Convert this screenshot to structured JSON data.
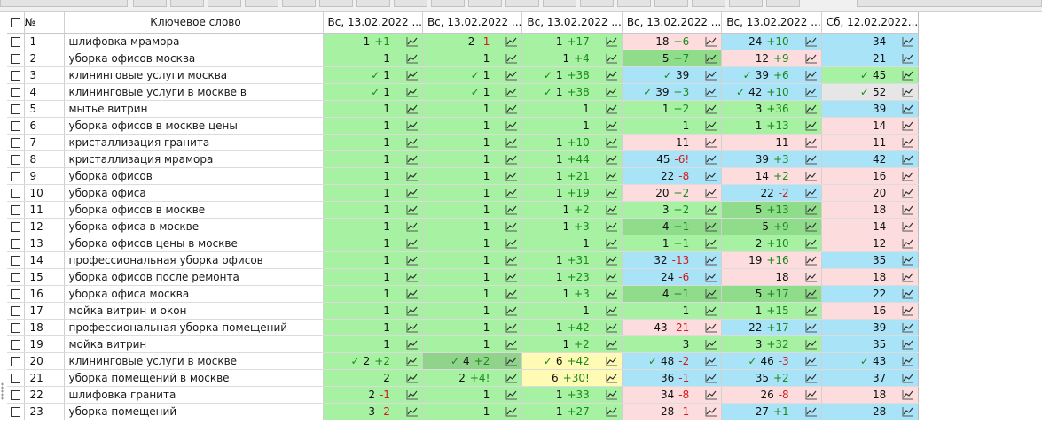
{
  "header": {
    "num": "№",
    "keyword": "Ключевое слово",
    "days": [
      "Вс, 13.02.2022 ...",
      "Вс, 13.02.2022 ...",
      "Вс, 13.02.2022 ...",
      "Вс, 13.02.2022 ...",
      "Вс, 13.02.2022 ...",
      "Сб, 12.02.2022..."
    ]
  },
  "colors": {
    "green": "#a6f2a2",
    "dgreen": "#8fdc8a",
    "pink": "#fcdcdc",
    "blue": "#a9e3f7",
    "yellow": "#fffbb5",
    "gray": "#e6e6e6",
    "up": "#1a8a1a",
    "down": "#d41a1a"
  },
  "icons": {
    "trend": "trend-chart-icon",
    "check": "checkmark"
  },
  "rows": [
    {
      "n": "1",
      "kw": "шлифовка мрамора",
      "c": [
        [
          "green",
          false,
          "1",
          "+1"
        ],
        [
          "green",
          false,
          "2",
          "-1"
        ],
        [
          "green",
          false,
          "1",
          "+17"
        ],
        [
          "pink",
          false,
          "18",
          "+6"
        ],
        [
          "blue",
          false,
          "24",
          "+10"
        ],
        [
          "blue",
          false,
          "34",
          ""
        ]
      ]
    },
    {
      "n": "2",
      "kw": "уборка офисов москва",
      "c": [
        [
          "green",
          false,
          "1",
          ""
        ],
        [
          "green",
          false,
          "1",
          ""
        ],
        [
          "green",
          false,
          "1",
          "+4"
        ],
        [
          "dgreen",
          false,
          "5",
          "+7"
        ],
        [
          "pink",
          false,
          "12",
          "+9"
        ],
        [
          "blue",
          false,
          "21",
          ""
        ]
      ]
    },
    {
      "n": "3",
      "kw": "клининговые услуги москва",
      "c": [
        [
          "green",
          true,
          "1",
          ""
        ],
        [
          "green",
          true,
          "1",
          ""
        ],
        [
          "green",
          true,
          "1",
          "+38"
        ],
        [
          "blue",
          true,
          "39",
          ""
        ],
        [
          "blue",
          true,
          "39",
          "+6"
        ],
        [
          "green",
          true,
          "45",
          ""
        ]
      ]
    },
    {
      "n": "4",
      "kw": "клининговые услуги в москве в",
      "c": [
        [
          "green",
          true,
          "1",
          ""
        ],
        [
          "green",
          true,
          "1",
          ""
        ],
        [
          "green",
          true,
          "1",
          "+38"
        ],
        [
          "blue",
          true,
          "39",
          "+3"
        ],
        [
          "blue",
          true,
          "42",
          "+10"
        ],
        [
          "gray",
          true,
          "52",
          ""
        ]
      ]
    },
    {
      "n": "5",
      "kw": "мытье витрин",
      "c": [
        [
          "green",
          false,
          "1",
          ""
        ],
        [
          "green",
          false,
          "1",
          ""
        ],
        [
          "green",
          false,
          "1",
          ""
        ],
        [
          "green",
          false,
          "1",
          "+2"
        ],
        [
          "green",
          false,
          "3",
          "+36"
        ],
        [
          "blue",
          false,
          "39",
          ""
        ]
      ]
    },
    {
      "n": "6",
      "kw": "уборка офисов в москве цены",
      "c": [
        [
          "green",
          false,
          "1",
          ""
        ],
        [
          "green",
          false,
          "1",
          ""
        ],
        [
          "green",
          false,
          "1",
          ""
        ],
        [
          "green",
          false,
          "1",
          ""
        ],
        [
          "green",
          false,
          "1",
          "+13"
        ],
        [
          "pink",
          false,
          "14",
          ""
        ]
      ]
    },
    {
      "n": "7",
      "kw": "кристаллизация гранита",
      "c": [
        [
          "green",
          false,
          "1",
          ""
        ],
        [
          "green",
          false,
          "1",
          ""
        ],
        [
          "green",
          false,
          "1",
          "+10"
        ],
        [
          "pink",
          false,
          "11",
          ""
        ],
        [
          "pink",
          false,
          "11",
          ""
        ],
        [
          "pink",
          false,
          "11",
          ""
        ]
      ]
    },
    {
      "n": "8",
      "kw": "кристаллизация мрамора",
      "c": [
        [
          "green",
          false,
          "1",
          ""
        ],
        [
          "green",
          false,
          "1",
          ""
        ],
        [
          "green",
          false,
          "1",
          "+44"
        ],
        [
          "blue",
          false,
          "45",
          "-6!"
        ],
        [
          "blue",
          false,
          "39",
          "+3"
        ],
        [
          "blue",
          false,
          "42",
          ""
        ]
      ]
    },
    {
      "n": "9",
      "kw": "уборка офисов",
      "c": [
        [
          "green",
          false,
          "1",
          ""
        ],
        [
          "green",
          false,
          "1",
          ""
        ],
        [
          "green",
          false,
          "1",
          "+21"
        ],
        [
          "blue",
          false,
          "22",
          "-8"
        ],
        [
          "pink",
          false,
          "14",
          "+2"
        ],
        [
          "pink",
          false,
          "16",
          ""
        ]
      ]
    },
    {
      "n": "10",
      "kw": "уборка офиса",
      "c": [
        [
          "green",
          false,
          "1",
          ""
        ],
        [
          "green",
          false,
          "1",
          ""
        ],
        [
          "green",
          false,
          "1",
          "+19"
        ],
        [
          "pink",
          false,
          "20",
          "+2"
        ],
        [
          "blue",
          false,
          "22",
          "-2"
        ],
        [
          "pink",
          false,
          "20",
          ""
        ]
      ]
    },
    {
      "n": "11",
      "kw": "уборка офисов в москве",
      "c": [
        [
          "green",
          false,
          "1",
          ""
        ],
        [
          "green",
          false,
          "1",
          ""
        ],
        [
          "green",
          false,
          "1",
          "+2"
        ],
        [
          "green",
          false,
          "3",
          "+2"
        ],
        [
          "dgreen",
          false,
          "5",
          "+13"
        ],
        [
          "pink",
          false,
          "18",
          ""
        ]
      ]
    },
    {
      "n": "12",
      "kw": "уборка офиса в москве",
      "c": [
        [
          "green",
          false,
          "1",
          ""
        ],
        [
          "green",
          false,
          "1",
          ""
        ],
        [
          "green",
          false,
          "1",
          "+3"
        ],
        [
          "dgreen",
          false,
          "4",
          "+1"
        ],
        [
          "dgreen",
          false,
          "5",
          "+9"
        ],
        [
          "pink",
          false,
          "14",
          ""
        ]
      ]
    },
    {
      "n": "13",
      "kw": "уборка офисов цены в москве",
      "c": [
        [
          "green",
          false,
          "1",
          ""
        ],
        [
          "green",
          false,
          "1",
          ""
        ],
        [
          "green",
          false,
          "1",
          ""
        ],
        [
          "green",
          false,
          "1",
          "+1"
        ],
        [
          "green",
          false,
          "2",
          "+10"
        ],
        [
          "pink",
          false,
          "12",
          ""
        ]
      ]
    },
    {
      "n": "14",
      "kw": "профессиональная уборка офисов",
      "c": [
        [
          "green",
          false,
          "1",
          ""
        ],
        [
          "green",
          false,
          "1",
          ""
        ],
        [
          "green",
          false,
          "1",
          "+31"
        ],
        [
          "blue",
          false,
          "32",
          "-13"
        ],
        [
          "pink",
          false,
          "19",
          "+16"
        ],
        [
          "blue",
          false,
          "35",
          ""
        ]
      ]
    },
    {
      "n": "15",
      "kw": "уборка офисов после ремонта",
      "c": [
        [
          "green",
          false,
          "1",
          ""
        ],
        [
          "green",
          false,
          "1",
          ""
        ],
        [
          "green",
          false,
          "1",
          "+23"
        ],
        [
          "blue",
          false,
          "24",
          "-6"
        ],
        [
          "pink",
          false,
          "18",
          ""
        ],
        [
          "pink",
          false,
          "18",
          ""
        ]
      ]
    },
    {
      "n": "16",
      "kw": "уборка офиса москва",
      "c": [
        [
          "green",
          false,
          "1",
          ""
        ],
        [
          "green",
          false,
          "1",
          ""
        ],
        [
          "green",
          false,
          "1",
          "+3"
        ],
        [
          "dgreen",
          false,
          "4",
          "+1"
        ],
        [
          "dgreen",
          false,
          "5",
          "+17"
        ],
        [
          "blue",
          false,
          "22",
          ""
        ]
      ]
    },
    {
      "n": "17",
      "kw": "мойка витрин и окон",
      "c": [
        [
          "green",
          false,
          "1",
          ""
        ],
        [
          "green",
          false,
          "1",
          ""
        ],
        [
          "green",
          false,
          "1",
          ""
        ],
        [
          "green",
          false,
          "1",
          ""
        ],
        [
          "green",
          false,
          "1",
          "+15"
        ],
        [
          "pink",
          false,
          "16",
          ""
        ]
      ]
    },
    {
      "n": "18",
      "kw": "профессиональная уборка помещений",
      "c": [
        [
          "green",
          false,
          "1",
          ""
        ],
        [
          "green",
          false,
          "1",
          ""
        ],
        [
          "green",
          false,
          "1",
          "+42"
        ],
        [
          "pink",
          false,
          "43",
          "-21"
        ],
        [
          "blue",
          false,
          "22",
          "+17"
        ],
        [
          "blue",
          false,
          "39",
          ""
        ]
      ]
    },
    {
      "n": "19",
      "kw": "мойка витрин",
      "c": [
        [
          "green",
          false,
          "1",
          ""
        ],
        [
          "green",
          false,
          "1",
          ""
        ],
        [
          "green",
          false,
          "1",
          "+2"
        ],
        [
          "green",
          false,
          "3",
          ""
        ],
        [
          "green",
          false,
          "3",
          "+32"
        ],
        [
          "blue",
          false,
          "35",
          ""
        ]
      ]
    },
    {
      "n": "20",
      "kw": "клининговые услуги в москве",
      "c": [
        [
          "green",
          true,
          "2",
          "+2"
        ],
        [
          "olive",
          true,
          "4",
          "+2"
        ],
        [
          "yellow",
          true,
          "6",
          "+42"
        ],
        [
          "blue",
          true,
          "48",
          "-2"
        ],
        [
          "blue",
          true,
          "46",
          "-3"
        ],
        [
          "blue",
          true,
          "43",
          ""
        ]
      ]
    },
    {
      "n": "21",
      "kw": "уборка помещений в москве",
      "c": [
        [
          "green",
          false,
          "2",
          ""
        ],
        [
          "green",
          false,
          "2",
          "+4!"
        ],
        [
          "yellow",
          false,
          "6",
          "+30!"
        ],
        [
          "blue",
          false,
          "36",
          "-1"
        ],
        [
          "blue",
          false,
          "35",
          "+2"
        ],
        [
          "blue",
          false,
          "37",
          ""
        ]
      ]
    },
    {
      "n": "22",
      "kw": "шлифовка гранита",
      "c": [
        [
          "green",
          false,
          "2",
          "-1"
        ],
        [
          "green",
          false,
          "1",
          ""
        ],
        [
          "green",
          false,
          "1",
          "+33"
        ],
        [
          "pink",
          false,
          "34",
          "-8"
        ],
        [
          "pink",
          false,
          "26",
          "-8"
        ],
        [
          "pink",
          false,
          "18",
          ""
        ]
      ]
    },
    {
      "n": "23",
      "kw": "уборка помещений",
      "c": [
        [
          "green",
          false,
          "3",
          "-2"
        ],
        [
          "green",
          false,
          "1",
          ""
        ],
        [
          "green",
          false,
          "1",
          "+27"
        ],
        [
          "pink",
          false,
          "28",
          "-1"
        ],
        [
          "blue",
          false,
          "27",
          "+1"
        ],
        [
          "blue",
          false,
          "28",
          ""
        ]
      ]
    }
  ]
}
